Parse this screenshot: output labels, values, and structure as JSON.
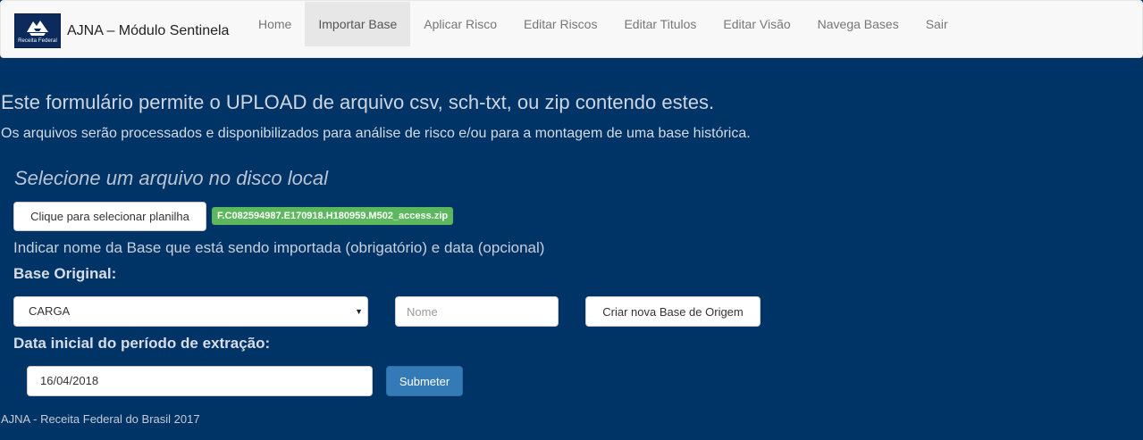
{
  "navbar": {
    "brand": {
      "logo_text": "Receita Federal",
      "app_name": "AJNA – Módulo Sentinela"
    },
    "items": [
      {
        "label": "Home",
        "active": false
      },
      {
        "label": "Importar Base",
        "active": true
      },
      {
        "label": "Aplicar Risco",
        "active": false
      },
      {
        "label": "Editar Riscos",
        "active": false
      },
      {
        "label": "Editar Titulos",
        "active": false
      },
      {
        "label": "Editar Visão",
        "active": false
      },
      {
        "label": "Navega Bases",
        "active": false
      },
      {
        "label": "Sair",
        "active": false
      }
    ]
  },
  "main": {
    "lead": "Este formulário permite o UPLOAD de arquivo csv, sch-txt, ou zip contendo estes.",
    "sublead": "Os arquivos serão processados e disponibilizados para análise de risco e/ou para a montagem de uma base histórica.",
    "section_title": "Selecione um arquivo no disco local",
    "file_button_label": "Clique para selecionar planilha",
    "selected_file": "F.C082594987.E170918.H180959.M502_access.zip",
    "hint": "Indicar nome da Base que está sendo importada (obrigatório) e data (opcional)",
    "base_label": "Base Original:",
    "base_select_value": "CARGA",
    "base_name_placeholder": "Nome",
    "create_base_label": "Criar nova Base de Origem",
    "date_label": "Data inicial do período de extração:",
    "date_value": "16/04/2018",
    "submit_label": "Submeter"
  },
  "footer": {
    "text": "AJNA - Receita Federal do Brasil 2017"
  },
  "colors": {
    "background": "#003366",
    "navbar_bg": "#f8f8f8",
    "active_tab_bg": "#e7e7e7",
    "file_badge": "#5cb85c",
    "primary_button": "#337ab7"
  }
}
